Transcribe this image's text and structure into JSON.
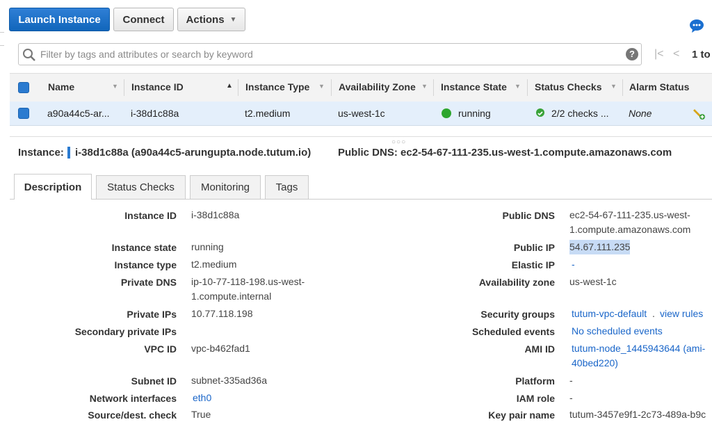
{
  "toolbar": {
    "launch_label": "Launch Instance",
    "connect_label": "Connect",
    "actions_label": "Actions"
  },
  "search": {
    "placeholder": "Filter by tags and attributes or search by keyword",
    "help": "?"
  },
  "pager": {
    "first": "|<",
    "prev": "<",
    "text": "1 to"
  },
  "table": {
    "columns": [
      "Name",
      "Instance ID",
      "Instance Type",
      "Availability Zone",
      "Instance State",
      "Status Checks",
      "Alarm Status"
    ],
    "rows": [
      {
        "name": "a90a44c5-ar...",
        "instance_id": "i-38d1c88a",
        "type": "t2.medium",
        "zone": "us-west-1c",
        "state": "running",
        "checks": "2/2 checks ...",
        "alarm": "None"
      }
    ]
  },
  "instance_header": {
    "label": "Instance:",
    "id": "i-38d1c88a (a90a44c5-arungupta.node.tutum.io)",
    "dns": "Public DNS: ec2-54-67-111-235.us-west-1.compute.amazonaws.com"
  },
  "tabs": [
    "Description",
    "Status Checks",
    "Monitoring",
    "Tags"
  ],
  "description": {
    "left": [
      {
        "label": "Instance ID",
        "value": "i-38d1c88a"
      },
      {
        "label": "Instance state",
        "value": "running"
      },
      {
        "label": "Instance type",
        "value": "t2.medium"
      },
      {
        "label": "Private DNS",
        "value": "ip-10-77-118-198.us-west-1.compute.internal"
      },
      {
        "label": "Private IPs",
        "value": "10.77.118.198"
      },
      {
        "label": "Secondary private IPs",
        "value": ""
      },
      {
        "label": "VPC ID",
        "value": "vpc-b462fad1"
      },
      {
        "label": "Subnet ID",
        "value": "subnet-335ad36a"
      },
      {
        "label": "Network interfaces",
        "value": "eth0"
      },
      {
        "label": "Source/dest. check",
        "value": "True"
      }
    ],
    "right": [
      {
        "label": "Public DNS",
        "value": "ec2-54-67-111-235.us-west-1.compute.amazonaws.com"
      },
      {
        "label": "Public IP",
        "value": "54.67.111.235"
      },
      {
        "label": "Elastic IP",
        "value": "-"
      },
      {
        "label": "Availability zone",
        "value": "us-west-1c"
      },
      {
        "label": "Security groups",
        "value": "tutum-vpc-default",
        "extra": "view rules"
      },
      {
        "label": "Scheduled events",
        "value": "No scheduled events"
      },
      {
        "label": "AMI ID",
        "value": "tutum-node_1445943644 (ami-40bed220)"
      },
      {
        "label": "Platform",
        "value": "-"
      },
      {
        "label": "IAM role",
        "value": "-"
      },
      {
        "label": "Key pair name",
        "value": "tutum-3457e9f1-2c73-489a-b9c"
      }
    ]
  },
  "colors": {
    "primary": "#1166bb",
    "selected_row": "#e4effb",
    "running": "#2ea62e",
    "link": "#1a66c9"
  }
}
